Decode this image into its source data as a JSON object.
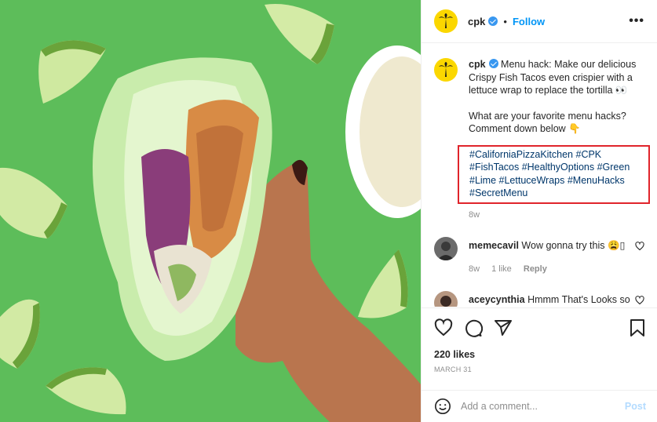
{
  "post": {
    "username": "cpk",
    "follow_label": "Follow",
    "more_label": "•••",
    "separator": "•"
  },
  "caption": {
    "username": "cpk",
    "text": "Menu hack: Make our delicious Crispy Fish Tacos even crispier with a lettuce wrap to replace the tortilla 👀",
    "question": "What are your favorite menu hacks? Comment down below 👇",
    "hashtags": "#CaliforniaPizzaKitchen #CPK #FishTacos #HealthyOptions #Green #Lime #LettuceWraps #MenuHacks #SecretMenu",
    "time": "8w"
  },
  "comments": [
    {
      "username": "memecavil",
      "text": "Wow gonna try this 😩▯",
      "time": "8w",
      "likes": "1 like",
      "reply": "Reply"
    },
    {
      "username": "aceycynthia",
      "text": "Hmmm That's Looks so"
    }
  ],
  "stats": {
    "likes": "220 likes",
    "date": "MARCH 31"
  },
  "composer": {
    "placeholder": "Add a comment...",
    "post_label": "Post"
  },
  "colors": {
    "image_background": "#5dbd5a",
    "accent": "#0095f6",
    "highlight_box": "#e0242b",
    "logo_yellow": "#fbd700"
  },
  "icons": [
    "palm-tree-icon",
    "verified-icon",
    "more-icon",
    "heart-icon",
    "comment-icon",
    "share-icon",
    "bookmark-icon",
    "emoji-icon"
  ]
}
